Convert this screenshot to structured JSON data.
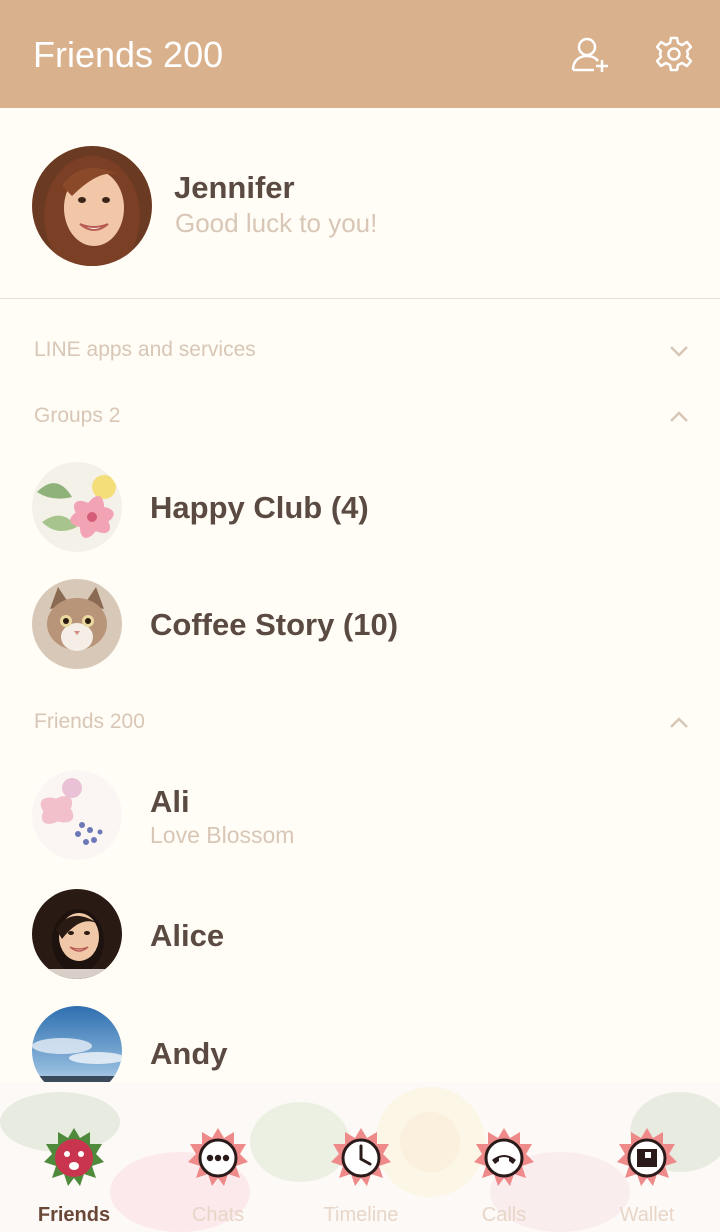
{
  "header": {
    "title": "Friends 200",
    "icons": [
      "add-friend-icon",
      "settings-icon"
    ]
  },
  "profile": {
    "name": "Jennifer",
    "status": "Good luck to you!"
  },
  "sections": {
    "apps": "LINE apps and services",
    "groups": "Groups 2",
    "friends": "Friends 200"
  },
  "groups": [
    {
      "name": "Happy Club (4)"
    },
    {
      "name": "Coffee Story (10)"
    }
  ],
  "friends": [
    {
      "name": "Ali",
      "status": "Love Blossom"
    },
    {
      "name": "Alice",
      "status": ""
    },
    {
      "name": "Andy",
      "status": ""
    }
  ],
  "nav": {
    "items": [
      {
        "label": "Friends",
        "icon": "friends-icon"
      },
      {
        "label": "Chats",
        "icon": "chats-icon"
      },
      {
        "label": "Timeline",
        "icon": "timeline-icon"
      },
      {
        "label": "Calls",
        "icon": "calls-icon"
      },
      {
        "label": "Wallet",
        "icon": "wallet-icon"
      }
    ]
  },
  "colors": {
    "header": "#d9b18c",
    "background": "#fffdf6",
    "text": "#5a4a42",
    "muted": "#d8c6b6",
    "accent": "#c9354f"
  }
}
